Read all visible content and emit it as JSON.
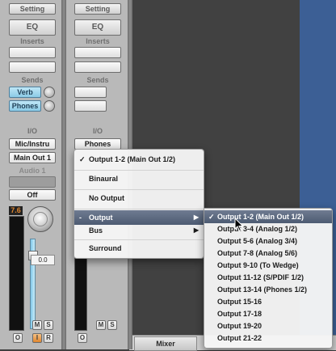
{
  "strip1": {
    "setting": "Setting",
    "eq": "EQ",
    "inserts_label": "Inserts",
    "sends_label": "Sends",
    "send1": "Verb",
    "send2": "Phones",
    "io_label": "I/O",
    "input": "Mic/Instru",
    "output": "Main Out 1",
    "name": "Audio 1",
    "automation": "Off",
    "peak": "7.6",
    "volume": "0.0",
    "mute": "M",
    "solo": "S",
    "rec": "O",
    "input_mon": "I",
    "record": "R"
  },
  "strip2": {
    "setting": "Setting",
    "eq": "EQ",
    "inserts_label": "Inserts",
    "sends_label": "Sends",
    "io_label": "I/O",
    "output": "Phones",
    "mute": "M",
    "solo": "S",
    "rec": "O"
  },
  "bottom_tab": "Mixer",
  "menu": {
    "items": [
      {
        "label": "Output 1-2  (Main Out 1/2)",
        "checked": "✓"
      },
      {
        "label": "Binaural"
      },
      {
        "label": "No Output"
      },
      {
        "label": "Output",
        "prefix": "-",
        "arrow": "▶"
      },
      {
        "label": "Bus",
        "arrow": "▶"
      },
      {
        "label": "Surround"
      }
    ]
  },
  "submenu": {
    "items": [
      {
        "label": "Output 1-2  (Main Out 1/2)",
        "checked": "✓"
      },
      {
        "label": "Output 3-4  (Analog 1/2)"
      },
      {
        "label": "Output 5-6  (Analog 3/4)"
      },
      {
        "label": "Output 7-8  (Analog 5/6)"
      },
      {
        "label": "Output 9-10  (To Wedge)"
      },
      {
        "label": "Output 11-12  (S/PDIF 1/2)"
      },
      {
        "label": "Output 13-14  (Phones 1/2)"
      },
      {
        "label": "Output 15-16"
      },
      {
        "label": "Output 17-18"
      },
      {
        "label": "Output 19-20"
      },
      {
        "label": "Output 21-22"
      }
    ]
  },
  "colors": {
    "send_blue": "#9fd6ee",
    "peak_orange": "#e0862e",
    "highlight": "#56627a",
    "arrange_blue": "#3c5f95"
  }
}
